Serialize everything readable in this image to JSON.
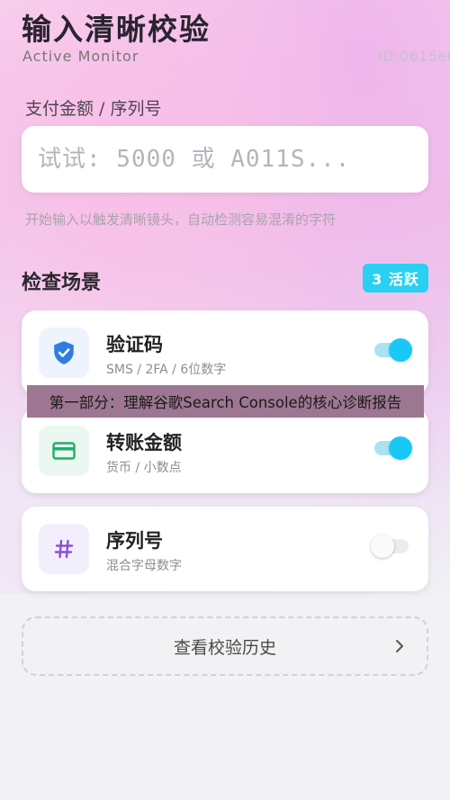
{
  "header": {
    "title": "输入清晰校验",
    "subtitle": "Active Monitor",
    "device_id": "ID:0615e0"
  },
  "amount_field": {
    "label": "支付金额 / 序列号",
    "placeholder": "试试: 5000 或 A011S...",
    "value": "",
    "hint": "开始输入以触发清晰镜头，自动检测容易混淆的字符"
  },
  "scenarios": {
    "title": "检查场景",
    "badge": "3 活跃",
    "items": [
      {
        "title": "验证码",
        "subtitle": "SMS / 2FA / 6位数字",
        "icon": "shield-check-icon",
        "icon_color": "#2f7de1",
        "tile_color": "#eef4fd",
        "enabled": true
      },
      {
        "title": "转账金额",
        "subtitle": "货币 / 小数点",
        "icon": "credit-card-icon",
        "icon_color": "#1fae6a",
        "tile_color": "#eaf8f1",
        "enabled": true
      },
      {
        "title": "序列号",
        "subtitle": "混合字母数字",
        "icon": "hash-icon",
        "icon_color": "#8b4fd8",
        "tile_color": "#f3eefc",
        "enabled": false
      }
    ]
  },
  "overlay": {
    "text": "第一部分：理解谷歌Search Console的核心诊断报告"
  },
  "history": {
    "label": "查看校验历史"
  },
  "colors": {
    "accent": "#18c9f5",
    "badge": "#2ad0f2"
  }
}
